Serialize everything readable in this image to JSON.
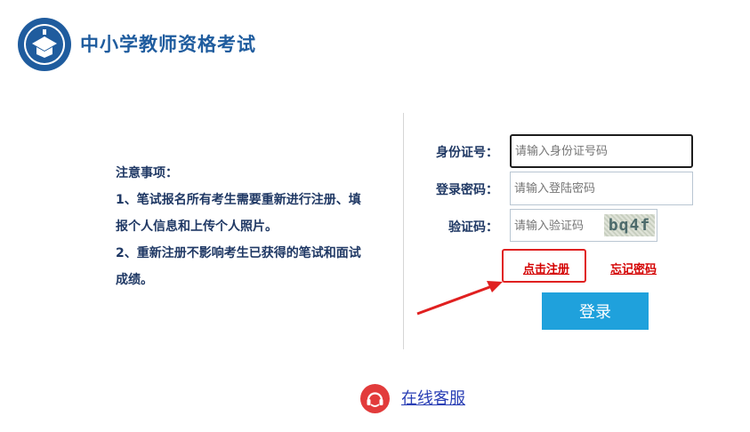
{
  "header": {
    "site_title": "中小学教师资格考试",
    "logo_icon": "ntce-seal-logo"
  },
  "notice": {
    "title": "注意事项：",
    "lines": [
      "1、笔试报名所有考生需要重新进行注册、填",
      "报个人信息和上传个人照片。",
      "2、重新注册不影响考生已获得的笔试和面试",
      "成绩。"
    ]
  },
  "login_form": {
    "id_label": "身份证号：",
    "id_placeholder": "请输入身份证号码",
    "password_label": "登录密码：",
    "password_placeholder": "请输入登陆密码",
    "captcha_label": "验证码：",
    "captcha_placeholder": "请输入验证码",
    "captcha_text": "bq4f",
    "register_link": "点击注册",
    "forgot_link": "忘记密码",
    "login_button": "登录"
  },
  "support": {
    "label": "在线客服",
    "icon": "headset-icon"
  },
  "colors": {
    "brand_blue": "#1f5c9e",
    "login_button": "#1fa1dc",
    "highlight_red": "#e02020",
    "link_red": "#d40000",
    "support_link": "#2a3fb5"
  }
}
